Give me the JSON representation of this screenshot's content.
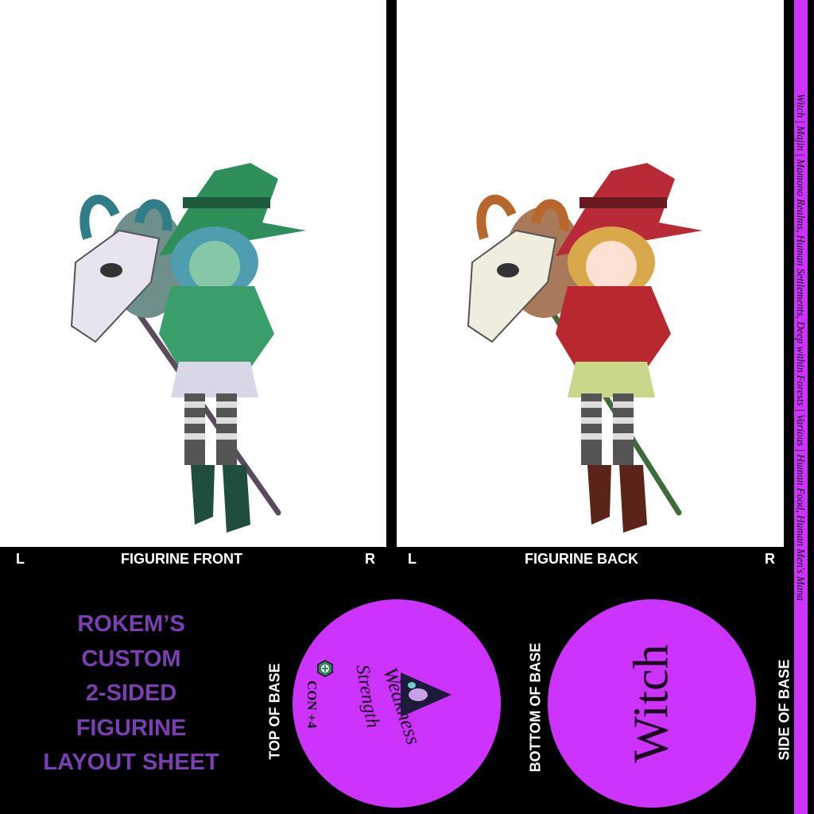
{
  "front": {
    "left_mark": "L",
    "title": "FIGURINE FRONT",
    "right_mark": "R"
  },
  "back": {
    "left_mark": "L",
    "title": "FIGURINE BACK",
    "right_mark": "R"
  },
  "sheet_title": [
    "ROKEM’S",
    "CUSTOM",
    "2-SIDED",
    "FIGURINE",
    "LAYOUT SHEET"
  ],
  "labels": {
    "top_of_base": "TOP OF BASE",
    "bottom_of_base": "BOTTOM OF BASE",
    "side_of_base": "SIDE OF BASE"
  },
  "top_base": {
    "weakness": "Weakness",
    "strength": "Strength",
    "stat": "CON +4",
    "icon": "shield-plus-icon"
  },
  "bottom_base": {
    "name": "Witch"
  },
  "side_strip": {
    "text": "Witch | Majin | Mamono Realms, Human Settlements, Deep within Forests | Various | Human Food, Human Men's Mana"
  },
  "colors": {
    "accent": "#cc33ff",
    "title_purple": "#7a3fb0",
    "front_outfit": "#3a9e6a",
    "back_outfit": "#b8282e"
  }
}
